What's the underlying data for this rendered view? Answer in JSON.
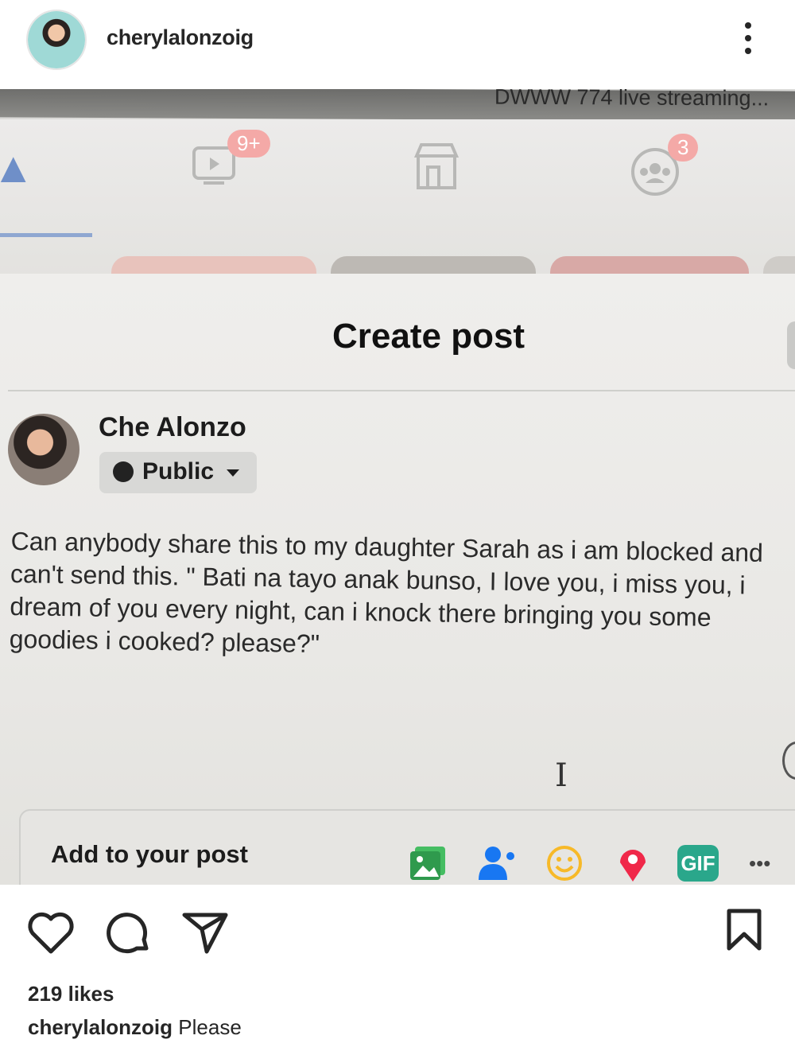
{
  "post": {
    "username": "cherylalonzoig"
  },
  "photo": {
    "topbar": {
      "live_text": "DWWW 774 live streaming..."
    },
    "nav": {
      "video_badge": "9+",
      "groups_badge": "3"
    },
    "create_post": {
      "title": "Create post",
      "author": "Che Alonzo",
      "audience": "Public",
      "text": "Can anybody share this to my daughter Sarah as i am blocked and can't send this. \" Bati na tayo anak bunso, I love you, i miss you, i dream of you every night, can i knock there bringing you some goodies i cooked? please?\"",
      "add_to_post": "Add to your post",
      "gif_label": "GIF",
      "more_label": "•••"
    }
  },
  "actions": {
    "likes": "219 likes",
    "caption_user": "cherylalonzoig",
    "caption_text": "Please"
  },
  "colors": {
    "photo_icon_green": "#45bd62",
    "tag_blue": "#1877f2",
    "feeling_yellow": "#f7b928",
    "location_red": "#f02849",
    "gif_teal": "#2aa78b"
  }
}
